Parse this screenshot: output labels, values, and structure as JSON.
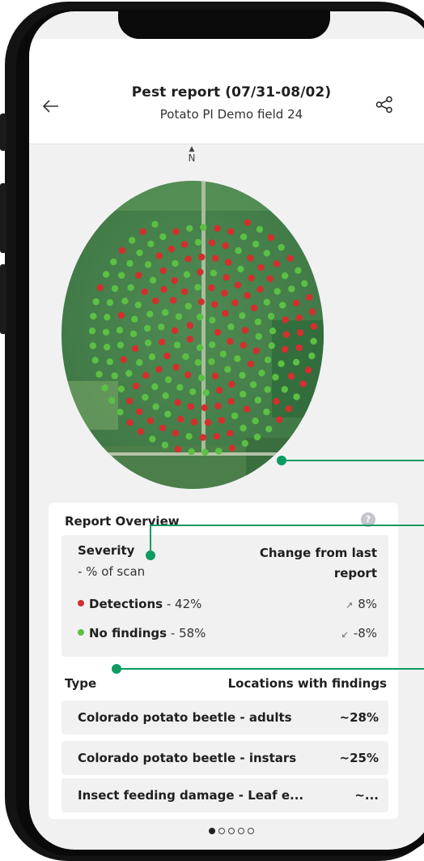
{
  "header": {
    "title": "Pest report (07/31-08/02)",
    "subtitle": "Potato PI Demo field 24"
  },
  "map": {
    "north_label": "N"
  },
  "overview": {
    "title": "Report Overview",
    "help_icon": "?",
    "severity_label": "Severity",
    "severity_sub": "- % of scan",
    "change_label": "Change from last report",
    "rows": [
      {
        "label": "Detections",
        "percent": "- 42%",
        "change": "8%",
        "direction": "up",
        "color": "#d32f2f"
      },
      {
        "label": "No findings",
        "percent": "- 58%",
        "change": "-8%",
        "direction": "down",
        "color": "#5bc043"
      }
    ],
    "type_label": "Type",
    "locations_label": "Locations with findings",
    "pests": [
      {
        "name": "Colorado potato beetle - adults",
        "value": "~28%"
      },
      {
        "name": "Colorado potato beetle - instars",
        "value": "~25%"
      },
      {
        "name": "Insect feeding damage - Leaf e...",
        "value": "~..."
      }
    ]
  },
  "pager": {
    "total": 5,
    "active": 0
  },
  "colors": {
    "accent": "#0d9b61",
    "detection": "#d32f2f",
    "no_finding": "#5bc043"
  }
}
